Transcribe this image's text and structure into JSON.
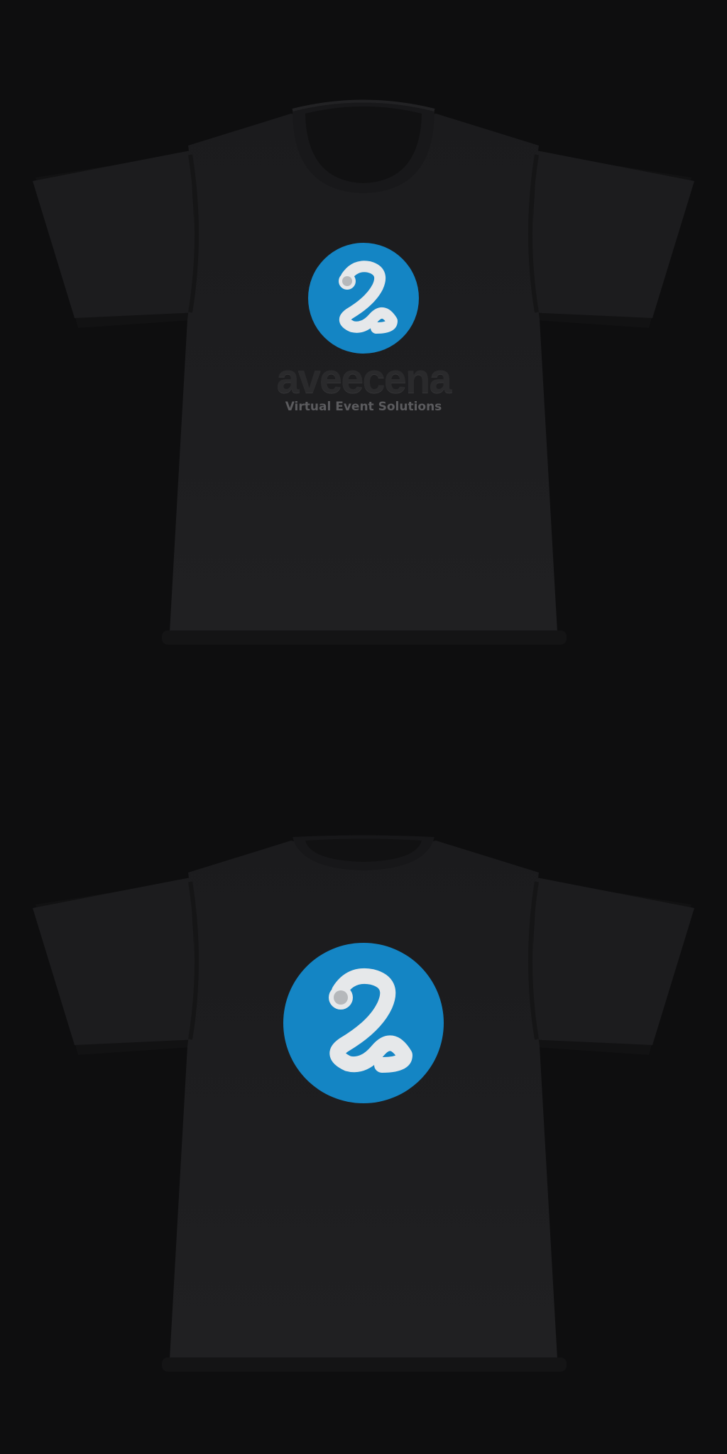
{
  "colors": {
    "background": "#0e0e0f",
    "shirt": "#1d1d1f",
    "shirt_shadow": "#121213",
    "logo_blue": "#1485c4",
    "logo_mark": "#e6e8ea",
    "logo_dot": "#b5b8bb",
    "wordmark": "#2a2a2c",
    "tagline": "#5b5b5e"
  },
  "front": {
    "logo_icon": "aveecena-logo-icon",
    "brand_name": "aveecena",
    "tagline": "Virtual Event Solutions"
  },
  "back": {
    "logo_icon": "aveecena-logo-icon"
  }
}
